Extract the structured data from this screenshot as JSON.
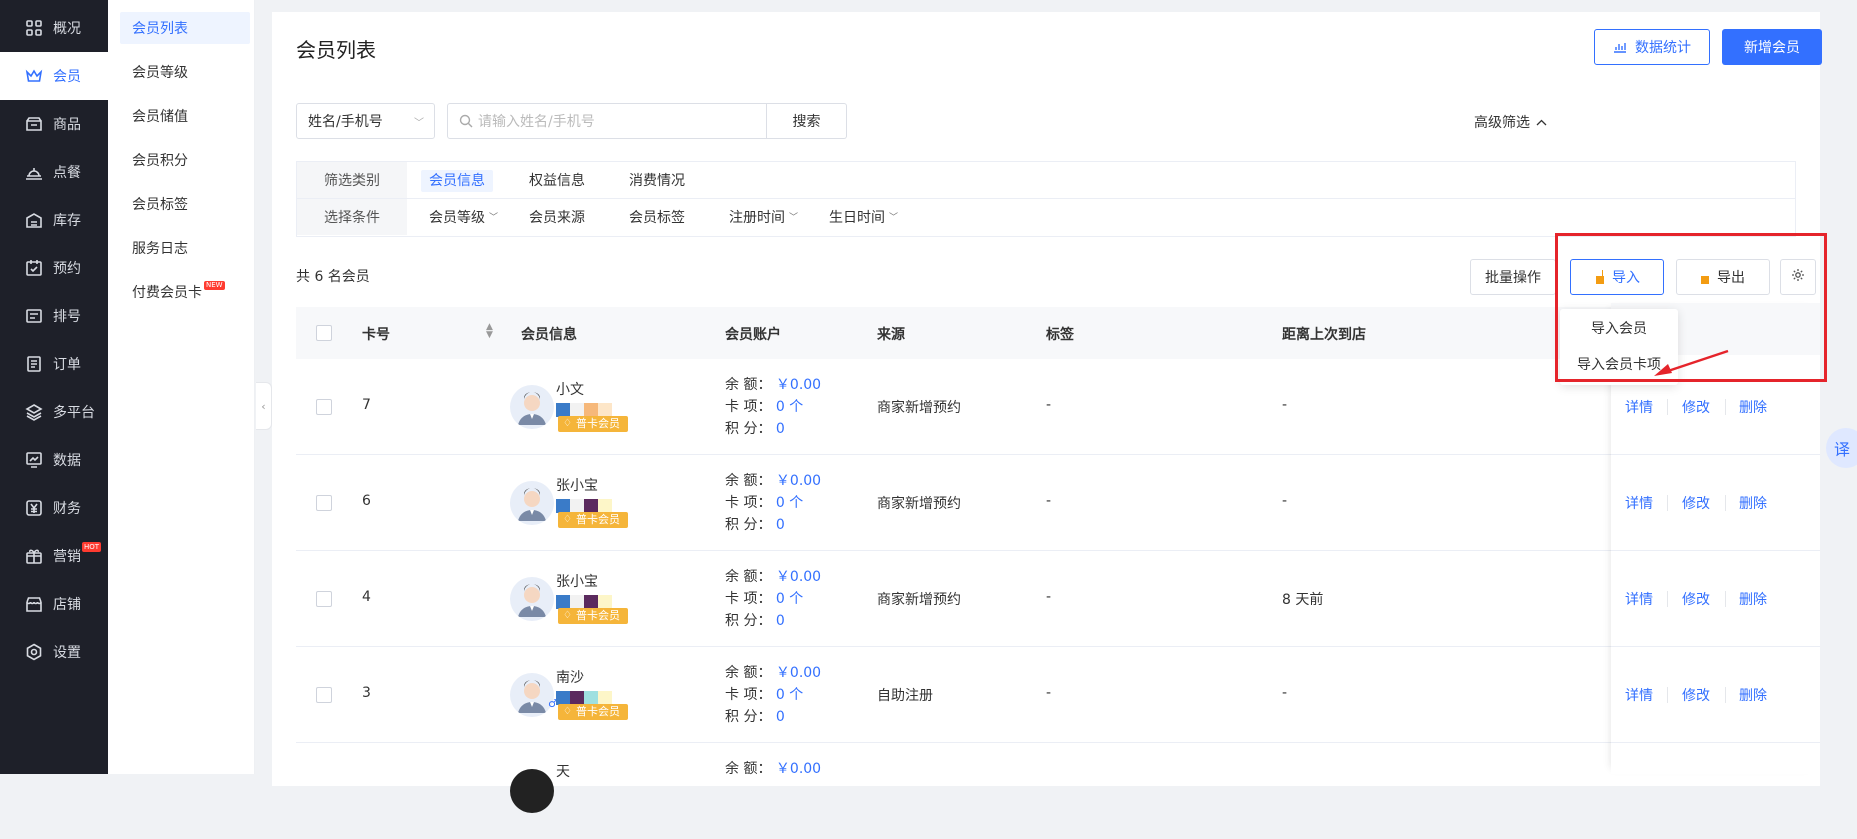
{
  "sidebar": {
    "items": [
      {
        "label": "概况",
        "icon": "grid-icon"
      },
      {
        "label": "会员",
        "icon": "crown-icon"
      },
      {
        "label": "商品",
        "icon": "shop-icon"
      },
      {
        "label": "点餐",
        "icon": "dish-icon"
      },
      {
        "label": "库存",
        "icon": "warehouse-icon"
      },
      {
        "label": "预约",
        "icon": "calendar-check-icon"
      },
      {
        "label": "排号",
        "icon": "queue-icon"
      },
      {
        "label": "订单",
        "icon": "order-icon"
      },
      {
        "label": "多平台",
        "icon": "layers-icon"
      },
      {
        "label": "数据",
        "icon": "chart-icon"
      },
      {
        "label": "财务",
        "icon": "yuan-icon"
      },
      {
        "label": "营销",
        "icon": "marketing-icon",
        "badge": "HOT"
      },
      {
        "label": "店铺",
        "icon": "store-icon"
      },
      {
        "label": "设置",
        "icon": "gear-icon"
      }
    ]
  },
  "subnav": {
    "items": [
      {
        "label": "会员列表"
      },
      {
        "label": "会员等级"
      },
      {
        "label": "会员储值"
      },
      {
        "label": "会员积分"
      },
      {
        "label": "会员标签"
      },
      {
        "label": "服务日志"
      },
      {
        "label": "付费会员卡",
        "badge": "NEW"
      }
    ]
  },
  "header": {
    "title": "会员列表",
    "stats_button": "数据统计",
    "add_button": "新增会员"
  },
  "search": {
    "select_value": "姓名/手机号",
    "placeholder": "请输入姓名/手机号",
    "button": "搜索",
    "advanced": "高级筛选"
  },
  "filters": {
    "category_label": "筛选类别",
    "categories": [
      "会员信息",
      "权益信息",
      "消费情况"
    ],
    "condition_label": "选择条件",
    "conditions": [
      "会员等级",
      "会员来源",
      "会员标签",
      "注册时间",
      "生日时间"
    ]
  },
  "toolbar": {
    "total": "共 6 名会员",
    "batch": "批量操作",
    "import": "导入",
    "export": "导出"
  },
  "import_menu": [
    "导入会员",
    "导入会员卡项"
  ],
  "table": {
    "headers": [
      "卡号",
      "会员信息",
      "会员账户",
      "来源",
      "标签",
      "距离上次到店"
    ],
    "labels": {
      "balance": "余 额：",
      "card": "卡 项：",
      "points": "积 分："
    },
    "actions": [
      "详情",
      "修改",
      "删除"
    ],
    "rows": [
      {
        "card_no": "7",
        "name": "小文",
        "badge": "普卡会员",
        "balance": "￥0.00",
        "cards": "0 个",
        "points": "0",
        "source": "商家新增预约",
        "tag": "-",
        "last_visit": "-"
      },
      {
        "card_no": "6",
        "name": "张小宝",
        "badge": "普卡会员",
        "balance": "￥0.00",
        "cards": "0 个",
        "points": "0",
        "source": "商家新增预约",
        "tag": "-",
        "last_visit": "-"
      },
      {
        "card_no": "4",
        "name": "张小宝",
        "badge": "普卡会员",
        "balance": "￥0.00",
        "cards": "0 个",
        "points": "0",
        "source": "商家新增预约",
        "tag": "-",
        "last_visit": "8 天前"
      },
      {
        "card_no": "3",
        "name": "南沙",
        "badge": "普卡会员",
        "balance": "￥0.00",
        "cards": "0 个",
        "points": "0",
        "source": "自助注册",
        "tag": "-",
        "last_visit": "-"
      },
      {
        "card_no": "",
        "name": "天",
        "badge": "",
        "balance": "￥0.00",
        "cards": "",
        "points": "",
        "source": "",
        "tag": "",
        "last_visit": ""
      }
    ]
  },
  "float_button": "译",
  "colors": {
    "primary": "#3370ff",
    "sidebar_bg": "#1e2029",
    "highlight": "#e5242b",
    "badge": "#f5b53a"
  }
}
